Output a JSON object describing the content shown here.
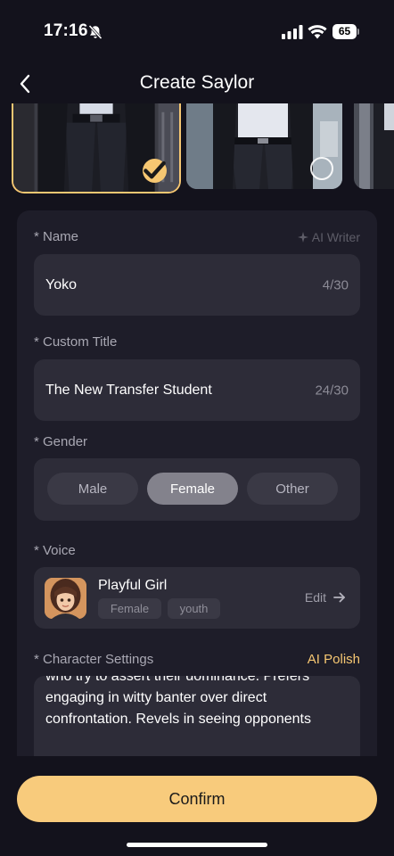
{
  "status_bar": {
    "time": "17:16",
    "battery": "65"
  },
  "nav": {
    "title": "Create Saylor"
  },
  "form": {
    "name": {
      "label": "* Name",
      "value": "Yoko",
      "count": "4/30",
      "ai_writer": "AI Writer"
    },
    "custom_title": {
      "label": "* Custom Title",
      "value": "The New Transfer Student",
      "count": "24/30"
    },
    "gender": {
      "label": "* Gender",
      "options": [
        "Male",
        "Female",
        "Other"
      ],
      "selected": "Female"
    },
    "voice": {
      "label": "* Voice",
      "name": "Playful Girl",
      "tags": [
        "Female",
        "youth"
      ],
      "edit": "Edit"
    },
    "character_settings": {
      "label": "* Character Settings",
      "ai_polish": "AI Polish",
      "text": "who try to assert their dominance. Prefers engaging in witty banter over direct confrontation. Revels in seeing opponents"
    }
  },
  "confirm_label": "Confirm",
  "colors": {
    "accent": "#f6c772",
    "background": "#13121c",
    "card": "#1e1d29",
    "field": "#2d2c38"
  }
}
